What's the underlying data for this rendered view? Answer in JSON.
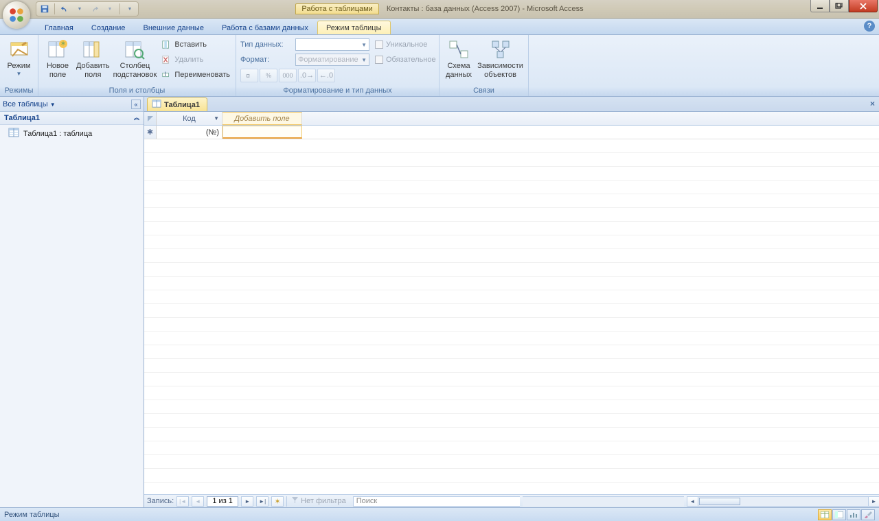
{
  "title": {
    "context": "Работа с таблицами",
    "main": "Контакты : база данных (Access 2007) - Microsoft Access"
  },
  "tabs": {
    "home": "Главная",
    "create": "Создание",
    "external": "Внешние данные",
    "dbtools": "Работа с базами данных",
    "datasheet": "Режим таблицы"
  },
  "ribbon": {
    "views": {
      "view": "Режим",
      "group": "Режимы"
    },
    "fields": {
      "newfield": "Новое\nполе",
      "addfields": "Добавить\nполя",
      "lookup": "Столбец\nподстановок",
      "insert": "Вставить",
      "delete": "Удалить",
      "rename": "Переименовать",
      "group": "Поля и столбцы"
    },
    "format": {
      "datatype": "Тип данных:",
      "format": "Формат:",
      "format_ph": "Форматирование",
      "unique": "Уникальное",
      "required": "Обязательное",
      "group": "Форматирование и тип данных",
      "cur": "%",
      "th": "000"
    },
    "rel": {
      "relations": "Схема\nданных",
      "deps": "Зависимости\nобъектов",
      "group": "Связи"
    }
  },
  "nav": {
    "header": "Все таблицы",
    "group": "Таблица1",
    "item": "Таблица1 : таблица"
  },
  "doc": {
    "tab": "Таблица1"
  },
  "grid": {
    "col_id": "Код",
    "col_add": "Добавить поле",
    "row_placeholder": "(№)"
  },
  "recnav": {
    "label": "Запись:",
    "pos": "1 из 1",
    "nofilter": "Нет фильтра",
    "search": "Поиск"
  },
  "status": {
    "mode": "Режим таблицы"
  }
}
